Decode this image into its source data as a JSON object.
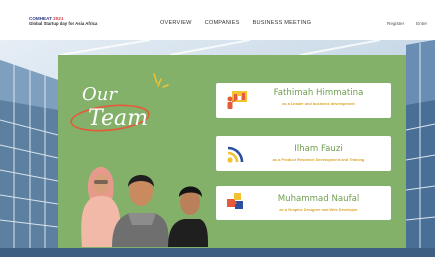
{
  "brand": {
    "logo_prefix": "COMHEAT ",
    "logo_year": "2021",
    "tagline": "Global Startup day for Asia Africa"
  },
  "nav": [
    "OVERVIEW",
    "COMPANIES",
    "BUSINESS MEETING"
  ],
  "account": {
    "register": "Register",
    "enter": "Enter"
  },
  "team": {
    "heading_line1": "Our",
    "heading_line2": "Team",
    "members": [
      {
        "name": "Fathimah Himmatina",
        "role": "as a Leader and business development",
        "icon": "presentation-icon"
      },
      {
        "name": "Ilham Fauzi",
        "role": "as a Product Research Development and Training",
        "icon": "rss-feed-icon"
      },
      {
        "name": "Muhammad Naufal",
        "role": "as a Graphic Designer and Web Developer",
        "icon": "puzzle-icon"
      }
    ]
  },
  "colors": {
    "panel_green": "#84b16a",
    "name_green": "#6f9f4f",
    "role_gold": "#d9a62a",
    "heading_ellipse": "#e45a3a",
    "accent_yellow": "#f2c230"
  }
}
